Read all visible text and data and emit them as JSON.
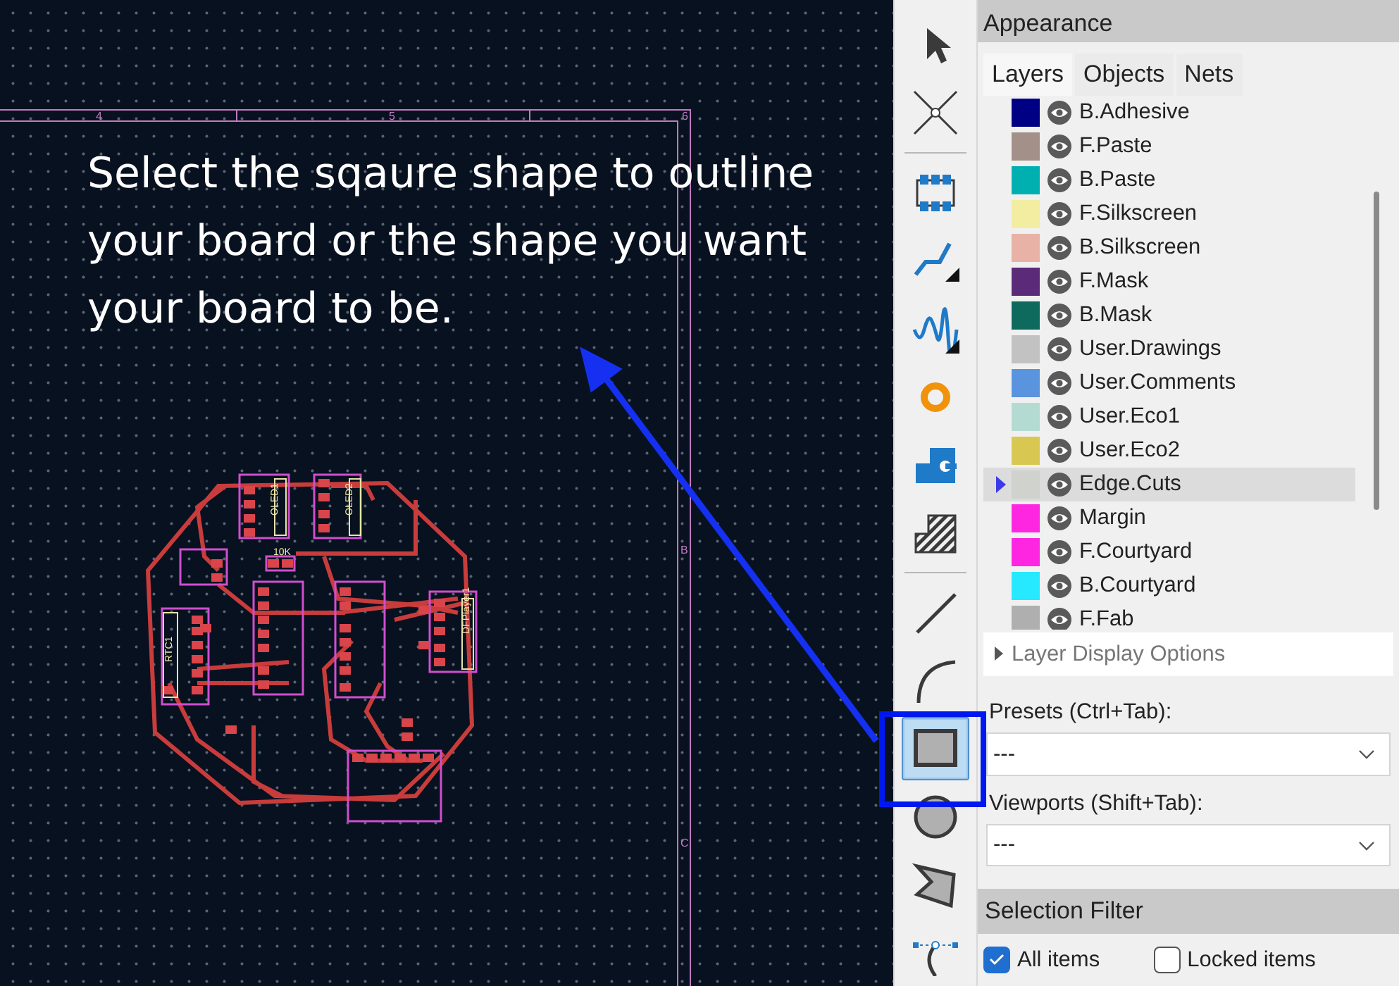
{
  "canvas": {
    "annotation": "Select the sqaure shape to outline your board or the shape you want your board to be.",
    "top_ruler_labels": [
      "4",
      "5",
      "6"
    ],
    "right_ruler_labels": [
      "B",
      "C"
    ],
    "component_labels": [
      "OLED1",
      "OLED2",
      "10K",
      "RTC1",
      "DFPlayer1"
    ]
  },
  "toolbar": {
    "tools": [
      {
        "kind": "select",
        "selected": false
      },
      {
        "kind": "cross",
        "selected": false
      },
      {
        "kind": "separator"
      },
      {
        "kind": "footprint",
        "selected": false
      },
      {
        "kind": "route",
        "selected": false
      },
      {
        "kind": "diffpair",
        "selected": false
      },
      {
        "kind": "via",
        "selected": false
      },
      {
        "kind": "pad",
        "selected": false
      },
      {
        "kind": "zone",
        "selected": false
      },
      {
        "kind": "separator"
      },
      {
        "kind": "line",
        "selected": false
      },
      {
        "kind": "arc",
        "selected": false
      },
      {
        "kind": "rectangle",
        "selected": true
      },
      {
        "kind": "circle",
        "selected": false
      },
      {
        "kind": "polygon",
        "selected": false
      },
      {
        "kind": "bezier",
        "selected": false
      }
    ]
  },
  "appearance": {
    "title": "Appearance",
    "tabs": [
      {
        "label": "Layers",
        "selected": true
      },
      {
        "label": "Objects",
        "selected": false
      },
      {
        "label": "Nets",
        "selected": false
      }
    ],
    "layers": [
      {
        "name": "B.Adhesive",
        "color": "#000084",
        "selected": false
      },
      {
        "name": "F.Paste",
        "color": "#a39088",
        "selected": false
      },
      {
        "name": "B.Paste",
        "color": "#00b0b0",
        "selected": false
      },
      {
        "name": "F.Silkscreen",
        "color": "#f2eda1",
        "selected": false
      },
      {
        "name": "B.Silkscreen",
        "color": "#e8b2a7",
        "selected": false
      },
      {
        "name": "F.Mask",
        "color": "#5b2a78",
        "selected": false
      },
      {
        "name": "B.Mask",
        "color": "#0f6a5e",
        "selected": false
      },
      {
        "name": "User.Drawings",
        "color": "#c2c2c2",
        "selected": false
      },
      {
        "name": "User.Comments",
        "color": "#5a94de",
        "selected": false
      },
      {
        "name": "User.Eco1",
        "color": "#b4dbd2",
        "selected": false
      },
      {
        "name": "User.Eco2",
        "color": "#d8c852",
        "selected": false
      },
      {
        "name": "Edge.Cuts",
        "color": "#d0d2cd",
        "selected": true
      },
      {
        "name": "Margin",
        "color": "#ff26e2",
        "selected": false
      },
      {
        "name": "F.Courtyard",
        "color": "#ff26e2",
        "selected": false
      },
      {
        "name": "B.Courtyard",
        "color": "#26e9ff",
        "selected": false
      },
      {
        "name": "F.Fab",
        "color": "#afafaf",
        "selected": false
      }
    ],
    "layer_display_options": "Layer Display Options",
    "presets": {
      "label": "Presets (Ctrl+Tab):",
      "value": "---"
    },
    "viewports": {
      "label": "Viewports (Shift+Tab):",
      "value": "---"
    }
  },
  "selection_filter": {
    "title": "Selection Filter",
    "items": [
      {
        "label": "All items",
        "checked": true
      },
      {
        "label": "Locked items",
        "checked": false
      }
    ]
  }
}
